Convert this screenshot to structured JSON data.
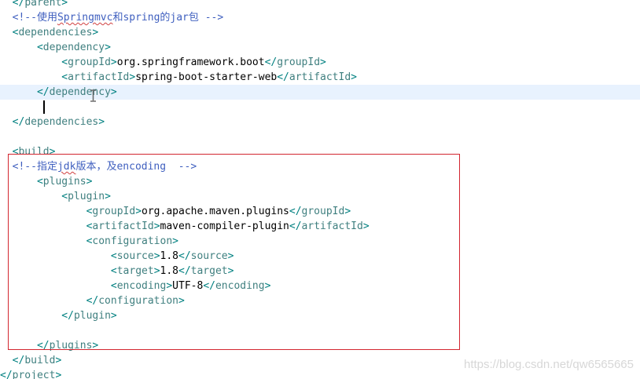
{
  "editor": {
    "lines": [
      {
        "indent": "  ",
        "open": "</",
        "tag": "parent",
        "close": ">"
      },
      {
        "indent": "  ",
        "comment_start": "<!--",
        "comment_body": "使用Springmvc和spring的jar包 -->"
      },
      {
        "indent": "  ",
        "open": "<",
        "tag": "dependencies",
        "close": ">"
      },
      {
        "indent": "      ",
        "open": "<",
        "tag": "dependency",
        "close": ">"
      },
      {
        "indent": "          ",
        "open": "<",
        "tag": "groupId",
        "close": ">",
        "value": "org.springframework.boot",
        "end_open": "</",
        "end_tag": "groupId",
        "end_close": ">"
      },
      {
        "indent": "          ",
        "open": "<",
        "tag": "artifactId",
        "close": ">",
        "value": "spring-boot-starter-web",
        "end_open": "</",
        "end_tag": "artifactId",
        "end_close": ">"
      },
      {
        "indent": "      ",
        "open": "</",
        "tag": "dependency",
        "close": ">"
      },
      {
        "indent": ""
      },
      {
        "indent": "  ",
        "open": "</",
        "tag": "dependencies",
        "close": ">"
      },
      {
        "indent": ""
      },
      {
        "indent": "  ",
        "open": "<",
        "tag": "build",
        "close": ">"
      },
      {
        "indent": "  ",
        "comment_start": "<!--",
        "comment_body": "指定jdk版本，及encoding  -->"
      },
      {
        "indent": "      ",
        "open": "<",
        "tag": "plugins",
        "close": ">"
      },
      {
        "indent": "          ",
        "open": "<",
        "tag": "plugin",
        "close": ">"
      },
      {
        "indent": "              ",
        "open": "<",
        "tag": "groupId",
        "close": ">",
        "value": "org.apache.maven.plugins",
        "end_open": "</",
        "end_tag": "groupId",
        "end_close": ">"
      },
      {
        "indent": "              ",
        "open": "<",
        "tag": "artifactId",
        "close": ">",
        "value": "maven-compiler-plugin",
        "end_open": "</",
        "end_tag": "artifactId",
        "end_close": ">"
      },
      {
        "indent": "              ",
        "open": "<",
        "tag": "configuration",
        "close": ">"
      },
      {
        "indent": "                  ",
        "open": "<",
        "tag": "source",
        "close": ">",
        "value": "1.8",
        "end_open": "</",
        "end_tag": "source",
        "end_close": ">"
      },
      {
        "indent": "                  ",
        "open": "<",
        "tag": "target",
        "close": ">",
        "value": "1.8",
        "end_open": "</",
        "end_tag": "target",
        "end_close": ">"
      },
      {
        "indent": "                  ",
        "open": "<",
        "tag": "encoding",
        "close": ">",
        "value": "UTF-8",
        "end_open": "</",
        "end_tag": "encoding",
        "end_close": ">"
      },
      {
        "indent": "              ",
        "open": "</",
        "tag": "configuration",
        "close": ">"
      },
      {
        "indent": "          ",
        "open": "</",
        "tag": "plugin",
        "close": ">"
      },
      {
        "indent": ""
      },
      {
        "indent": "      ",
        "open": "</",
        "tag": "plugins",
        "close": ">"
      },
      {
        "indent": "  ",
        "open": "</",
        "tag": "build",
        "close": ">"
      },
      {
        "indent": "",
        "open": "</",
        "tag": "project",
        "close": ">"
      }
    ],
    "current_line": 6,
    "squiggle_words": [
      "Springmvc",
      "jdk"
    ]
  },
  "watermark": "https://blog.csdn.net/qw6565665",
  "colors": {
    "tag": "#3f7f7f",
    "bracket": "#008080",
    "text": "#000000",
    "comment": "#3f5fbf",
    "current_line": "#e8f2fe",
    "highlight_box": "#d3262f"
  }
}
